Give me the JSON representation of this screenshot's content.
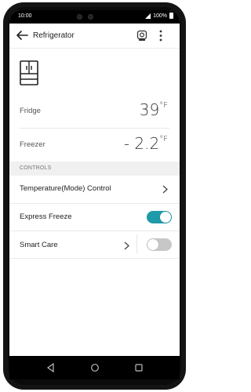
{
  "status_bar": {
    "time": "10:00",
    "battery": "100%"
  },
  "app_bar": {
    "title": "Refrigerator"
  },
  "fridge": {
    "label": "Fridge",
    "value": "39",
    "unit": "°F"
  },
  "freezer": {
    "label": "Freezer",
    "value": "- 2.2",
    "unit": "°F"
  },
  "section": {
    "controls_label": "CONTROLS"
  },
  "controls": {
    "temperature_mode": {
      "label": "Temperature(Mode) Control"
    },
    "express_freeze": {
      "label": "Express Freeze",
      "enabled": true
    },
    "smart_care": {
      "label": "Smart Care",
      "enabled": false
    }
  },
  "colors": {
    "accent": "#1e9aa8",
    "toggle_off": "#c7c7c7"
  },
  "icons": [
    "back-arrow-icon",
    "camera-icon",
    "more-vert-icon",
    "fridge-icon",
    "chevron-right-icon",
    "nav-back-icon",
    "nav-home-icon",
    "nav-recents-icon"
  ]
}
